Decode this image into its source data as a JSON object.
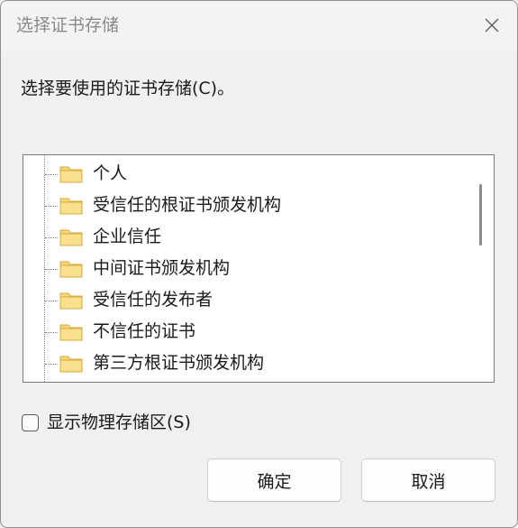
{
  "window": {
    "title": "选择证书存储"
  },
  "instruction": "选择要使用的证书存储(C)。",
  "tree": {
    "items": [
      {
        "label": "个人"
      },
      {
        "label": "受信任的根证书颁发机构"
      },
      {
        "label": "企业信任"
      },
      {
        "label": "中间证书颁发机构"
      },
      {
        "label": "受信任的发布者"
      },
      {
        "label": "不信任的证书"
      },
      {
        "label": "第三方根证书颁发机构"
      }
    ]
  },
  "show_physical": {
    "label": "显示物理存储区(S)",
    "checked": false
  },
  "buttons": {
    "ok": "确定",
    "cancel": "取消"
  },
  "colors": {
    "folder_fill": "#f5d77e",
    "folder_edge": "#d9a93c",
    "background": "#f0f0f0"
  },
  "icons": {
    "close": "close-icon",
    "folder": "folder-icon"
  }
}
